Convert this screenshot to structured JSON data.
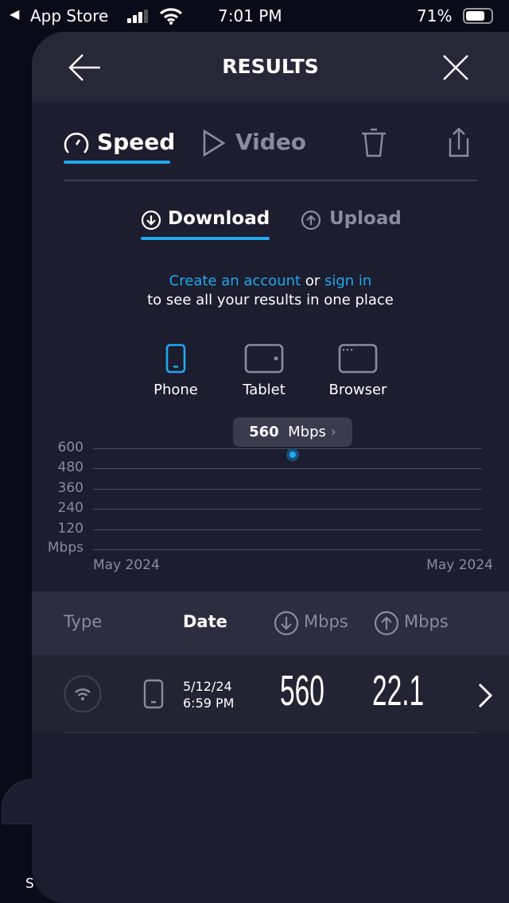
{
  "status_bar": {
    "back_app": "App Store",
    "time": "7:01 PM",
    "battery": "71%",
    "battery_level": 0.71
  },
  "header": {
    "title": "RESULTS"
  },
  "tabs": [
    {
      "label": "Speed",
      "active": true
    },
    {
      "label": "Video",
      "active": false
    }
  ],
  "subtabs": [
    {
      "label": "Download",
      "active": true
    },
    {
      "label": "Upload",
      "active": false
    }
  ],
  "signin": {
    "create": "Create an account",
    "or": "or",
    "sign_in": "sign in",
    "line2": "to see all your results in one place"
  },
  "devices": [
    {
      "label": "Phone",
      "active": true
    },
    {
      "label": "Tablet",
      "active": false
    },
    {
      "label": "Browser",
      "active": false
    }
  ],
  "tooltip": {
    "value": "560",
    "unit": "Mbps"
  },
  "chart_data": {
    "type": "scatter",
    "ylabel": "Mbps",
    "yticks": [
      "600",
      "480",
      "360",
      "240",
      "120"
    ],
    "ylim": [
      0,
      600
    ],
    "xticks": [
      "May 2024",
      "May 2024"
    ],
    "points": [
      {
        "x": "5/12/24 6:59 PM",
        "y": 560
      }
    ],
    "grid": true,
    "color": "#1fa9ef"
  },
  "table": {
    "headers": {
      "type": "Type",
      "date": "Date",
      "down": "Mbps",
      "up": "Mbps"
    },
    "rows": [
      {
        "date": "5/12/24",
        "time": "6:59 PM",
        "download": "560",
        "upload": "22.1"
      }
    ]
  },
  "background_peek": "S"
}
